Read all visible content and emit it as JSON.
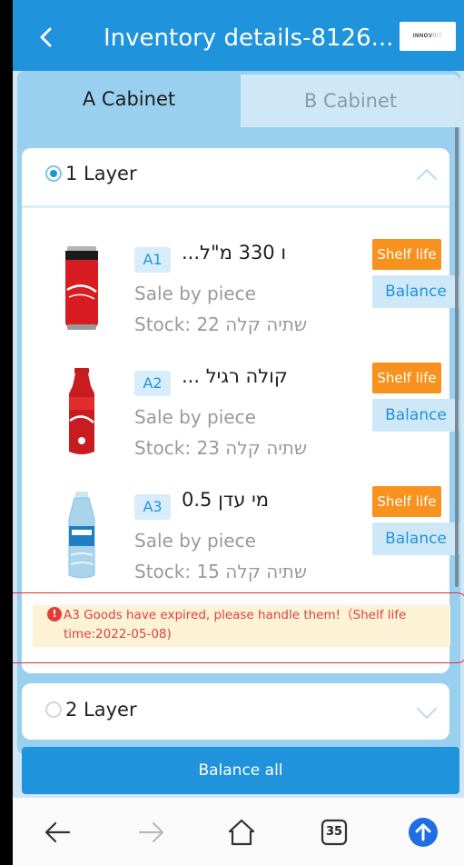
{
  "header": {
    "title": "Inventory details-8126...",
    "logo_main": "INNOV",
    "logo_suffix": "BIT"
  },
  "tabs": [
    {
      "label": "A Cabinet",
      "active": true
    },
    {
      "label": "B Cabinet",
      "active": false
    }
  ],
  "layers": [
    {
      "title": "1 Layer",
      "expanded": true,
      "items": [
        {
          "slot": "A1",
          "name": "...ו 330 מ\"ל",
          "sale_type": "Sale by piece",
          "stock": "Stock: 22 שתיה קלה",
          "shelf_label": "Shelf life",
          "balance_label": "Balance",
          "image": "coca-cola-can"
        },
        {
          "slot": "A2",
          "name": "... קולה רגיל",
          "sale_type": "Sale by piece",
          "stock": "Stock: 23 שתיה קלה",
          "shelf_label": "Shelf life",
          "balance_label": "Balance",
          "image": "coca-cola-bottle"
        },
        {
          "slot": "A3",
          "name": "מי עדן 0.5",
          "sale_type": "Sale by piece",
          "stock": "Stock: 15 שתיה קלה",
          "shelf_label": "Shelf life",
          "balance_label": "Balance",
          "image": "water-bottle"
        }
      ],
      "warning": "A3 Goods have expired, please handle them!（Shelf life time:2022-05-08)"
    },
    {
      "title": "2 Layer",
      "expanded": false
    }
  ],
  "balance_all_label": "Balance all",
  "browser_bar": {
    "tab_count": "35",
    "icons": [
      "back-arrow-icon",
      "forward-arrow-icon",
      "home-icon",
      "tabs-icon",
      "upload-icon"
    ]
  },
  "colors": {
    "primary": "#1f93db",
    "shelf_life": "#f7921e",
    "warning_text": "#e04040",
    "warning_bg": "#fcf2d6"
  }
}
